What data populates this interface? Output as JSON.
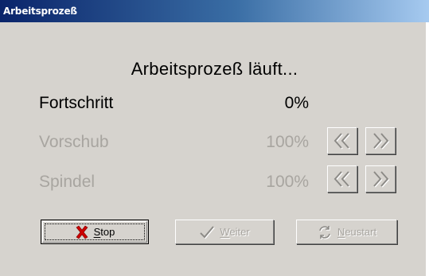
{
  "window": {
    "title": "Arbeitsprozeß"
  },
  "status_text": "Arbeitsprozeß läuft...",
  "rows": [
    {
      "label": "Fortschritt",
      "value": "0%",
      "enabled": true
    },
    {
      "label": "Vorschub",
      "value": "100%",
      "enabled": false
    },
    {
      "label": "Spindel",
      "value": "100%",
      "enabled": false
    }
  ],
  "buttons": {
    "stop": {
      "mnemonic": "S",
      "rest": "top"
    },
    "weiter": {
      "mnemonic": "W",
      "rest": "eiter"
    },
    "neustart": {
      "mnemonic": "N",
      "rest": "eustart"
    }
  },
  "icons": {
    "decrease": "double-chevron-left-icon",
    "increase": "double-chevron-right-icon",
    "stop": "red-x-icon",
    "weiter": "checkmark-icon",
    "neustart": "refresh-icon"
  },
  "colors": {
    "window_bg": "#d6d3ce",
    "title_bar_start": "#0a246a",
    "title_bar_end": "#a6caf0",
    "disabled_text": "#a8a5a0",
    "stop_icon": "#cc0000"
  }
}
